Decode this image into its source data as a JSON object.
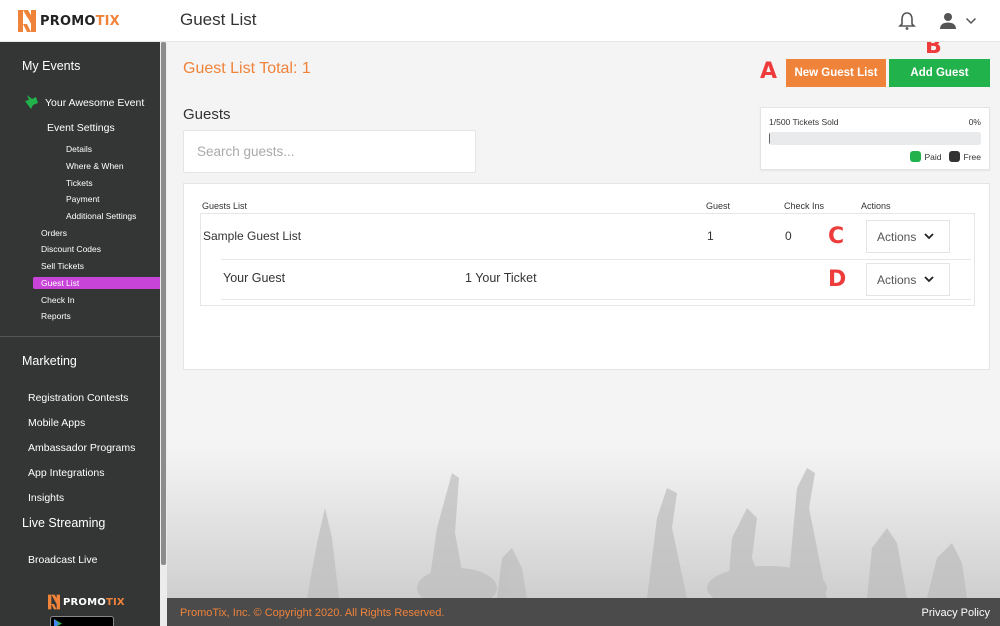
{
  "app": {
    "brand_left": "PROMO",
    "brand_right": "TIX",
    "page_title": "Guest List",
    "colors": {
      "accent_orange": "#f0833a",
      "green": "#22b24c",
      "active_nav": "#c844d8",
      "sidebar_bg": "#343635",
      "marker_red": "#ee3b3b"
    }
  },
  "header": {
    "notifications_icon": "bell-icon",
    "user_icon": "user-icon",
    "user_menu_icon": "chevron-down-icon"
  },
  "sidebar": {
    "my_events": "My Events",
    "event_name": "Your Awesome Event",
    "event_icon": "ticket-icon",
    "event_settings": "Event Settings",
    "settings_items": [
      "Details",
      "Where & When",
      "Tickets",
      "Payment",
      "Additional Settings"
    ],
    "event_items": [
      "Orders",
      "Discount Codes",
      "Sell Tickets",
      "Guest List",
      "Check In",
      "Reports"
    ],
    "active_item": "Guest List",
    "marketing": "Marketing",
    "marketing_items": [
      "Registration Contests",
      "Mobile Apps",
      "Ambassador Programs",
      "App Integrations",
      "Insights"
    ],
    "live_streaming": "Live Streaming",
    "live_items": [
      "Broadcast Live"
    ],
    "footer_brand_left": "PROMO",
    "footer_brand_right": "TIX",
    "store_badge": "GET IT ON Google Play"
  },
  "main": {
    "total_label": "Guest List Total: 1",
    "new_guest_list_button": "New Guest List",
    "add_guest_button": "Add Guest",
    "markers": {
      "a": "A",
      "b": "B",
      "c": "C",
      "d": "D"
    },
    "guests_heading": "Guests",
    "search": {
      "placeholder": "Search guests...",
      "value": ""
    },
    "tickets": {
      "sold_label": "1/500 Tickets Sold",
      "percent_label": "0%",
      "sold_fraction": 0.002,
      "legend": [
        {
          "label": "Paid",
          "color": "#22b24c"
        },
        {
          "label": "Free",
          "color": "#333333"
        }
      ]
    },
    "table": {
      "columns": [
        "Guests List",
        "Guest",
        "Check Ins",
        "Actions"
      ],
      "lists": [
        {
          "name": "Sample Guest List",
          "guest": "1",
          "check_ins": "0",
          "action_label": "Actions",
          "guests": [
            {
              "name": "Your Guest",
              "ticket": "1 Your Ticket",
              "action_label": "Actions"
            }
          ]
        }
      ]
    }
  },
  "footer": {
    "copyright": "PromoTix, Inc. © Copyright 2020. All Rights Reserved.",
    "privacy": "Privacy Policy"
  }
}
